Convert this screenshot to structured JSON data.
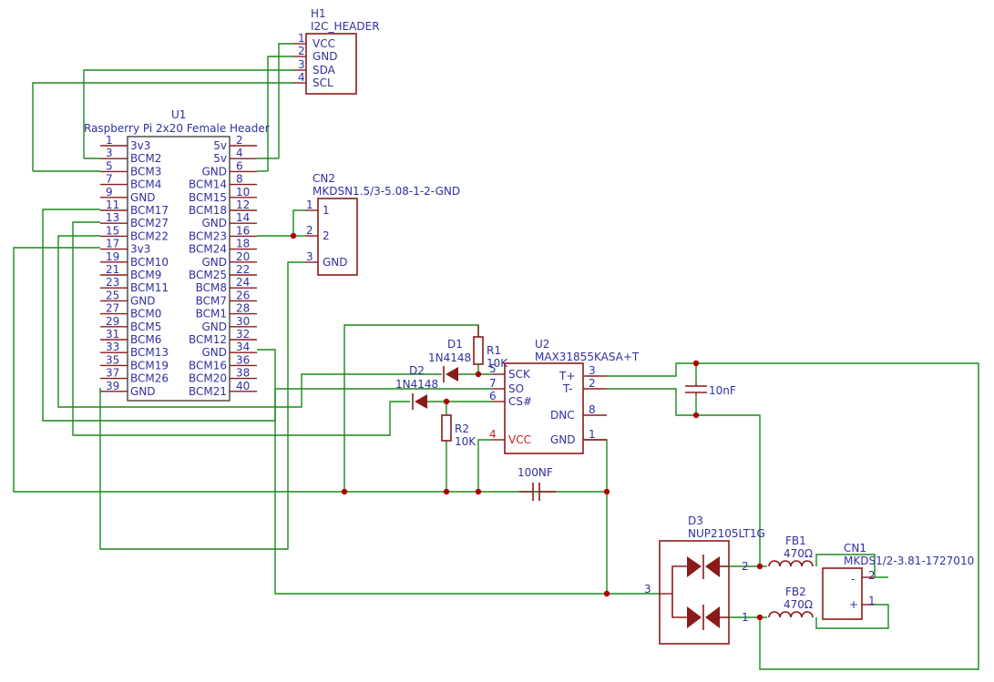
{
  "h1": {
    "ref": "H1",
    "value": "I2C_HEADER",
    "pins": [
      {
        "n": "1",
        "name": "VCC"
      },
      {
        "n": "2",
        "name": "GND"
      },
      {
        "n": "3",
        "name": "SDA"
      },
      {
        "n": "4",
        "name": "SCL"
      }
    ]
  },
  "u1": {
    "ref": "U1",
    "value": "Raspberry Pi 2x20 Female Header",
    "left": [
      [
        "1",
        "3v3"
      ],
      [
        "3",
        "BCM2"
      ],
      [
        "5",
        "BCM3"
      ],
      [
        "7",
        "BCM4"
      ],
      [
        "9",
        "GND"
      ],
      [
        "11",
        "BCM17"
      ],
      [
        "13",
        "BCM27"
      ],
      [
        "15",
        "BCM22"
      ],
      [
        "17",
        "3v3"
      ],
      [
        "19",
        "BCM10"
      ],
      [
        "21",
        "BCM9"
      ],
      [
        "23",
        "BCM11"
      ],
      [
        "25",
        "GND"
      ],
      [
        "27",
        "BCM0"
      ],
      [
        "29",
        "BCM5"
      ],
      [
        "31",
        "BCM6"
      ],
      [
        "33",
        "BCM13"
      ],
      [
        "35",
        "BCM19"
      ],
      [
        "37",
        "BCM26"
      ],
      [
        "39",
        "GND"
      ]
    ],
    "right": [
      [
        "2",
        "5v"
      ],
      [
        "4",
        "5v"
      ],
      [
        "6",
        "GND"
      ],
      [
        "8",
        "BCM14"
      ],
      [
        "10",
        "BCM15"
      ],
      [
        "12",
        "BCM18"
      ],
      [
        "14",
        "GND"
      ],
      [
        "16",
        "BCM23"
      ],
      [
        "18",
        "BCM24"
      ],
      [
        "20",
        "GND"
      ],
      [
        "22",
        "BCM25"
      ],
      [
        "24",
        "BCM8"
      ],
      [
        "26",
        "BCM7"
      ],
      [
        "28",
        "BCM1"
      ],
      [
        "30",
        "GND"
      ],
      [
        "32",
        "BCM12"
      ],
      [
        "34",
        "GND"
      ],
      [
        "36",
        "BCM16"
      ],
      [
        "38",
        "BCM20"
      ],
      [
        "40",
        "BCM21"
      ]
    ]
  },
  "cn2": {
    "ref": "CN2",
    "value": "MKDSN1.5/3-5.08-1-2-GND",
    "pins": [
      {
        "n": "1",
        "name": "1"
      },
      {
        "n": "2",
        "name": "2"
      },
      {
        "n": "3",
        "name": "GND"
      }
    ]
  },
  "u2": {
    "ref": "U2",
    "value": "MAX31855KASA+T",
    "left": [
      {
        "n": "5",
        "name": "SCK"
      },
      {
        "n": "7",
        "name": "SO"
      },
      {
        "n": "6",
        "name": "CS#"
      },
      {
        "n": "4",
        "name": "VCC"
      }
    ],
    "right": [
      {
        "n": "3",
        "name": "T+"
      },
      {
        "n": "2",
        "name": "T-"
      },
      {
        "n": "8",
        "name": "DNC"
      },
      {
        "n": "1",
        "name": "GND"
      }
    ]
  },
  "d1": {
    "ref": "D1",
    "value": "1N4148"
  },
  "d2": {
    "ref": "D2",
    "value": "1N4148"
  },
  "r1": {
    "ref": "R1",
    "value": "10K"
  },
  "r2": {
    "ref": "R2",
    "value": "10K"
  },
  "c_small": {
    "value": "10nF"
  },
  "c_big": {
    "value": "100NF"
  },
  "d3": {
    "ref": "D3",
    "value": "NUP2105LT1G",
    "pin_a": "2",
    "pin_b": "1",
    "pin_c": "3"
  },
  "fb1": {
    "ref": "FB1",
    "value": "470Ω"
  },
  "fb2": {
    "ref": "FB2",
    "value": "470Ω"
  },
  "cn1": {
    "ref": "CN1",
    "value": "MKDS1/2-3.81-1727010",
    "pins": [
      {
        "n": "2",
        "name": "-"
      },
      {
        "n": "1",
        "name": "+"
      }
    ]
  }
}
